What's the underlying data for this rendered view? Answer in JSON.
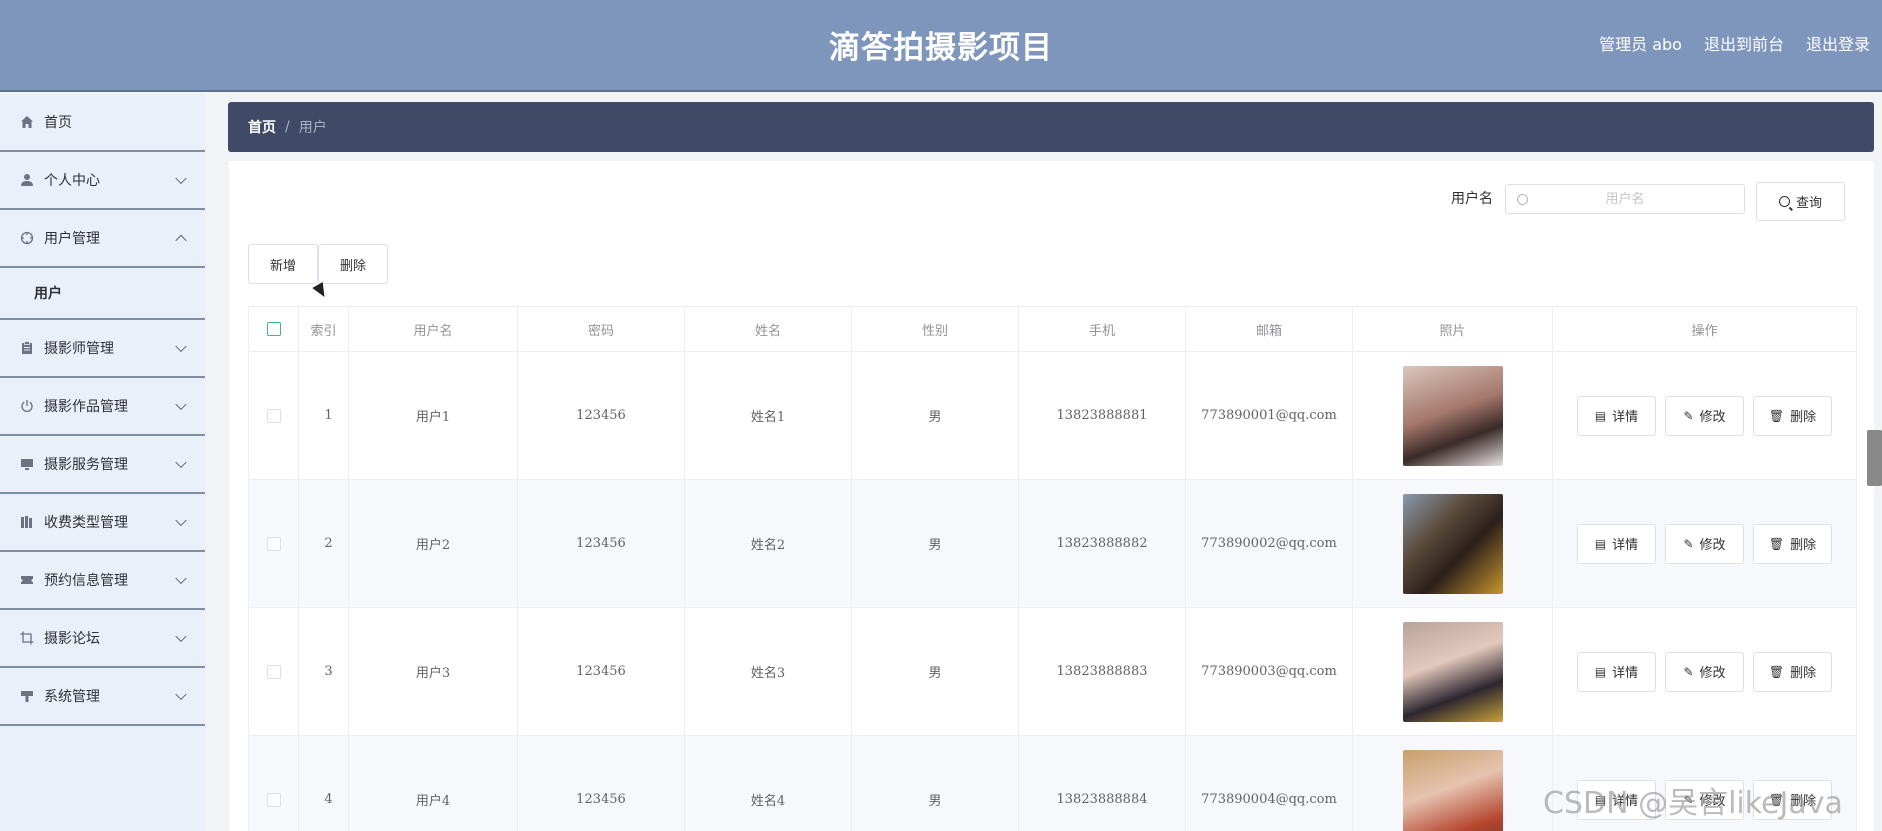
{
  "header": {
    "title": "滴答拍摄影项目",
    "admin": "管理员 abo",
    "to_front": "退出到前台",
    "logout": "退出登录"
  },
  "sidebar": {
    "items": [
      {
        "label": "首页",
        "icon": "home-icon"
      },
      {
        "label": "个人中心",
        "icon": "user-icon"
      },
      {
        "label": "用户管理",
        "icon": "crosshair-icon",
        "expanded": true,
        "sub": [
          "用户"
        ]
      },
      {
        "label": "摄影师管理",
        "icon": "clipboard-icon"
      },
      {
        "label": "摄影作品管理",
        "icon": "power-icon"
      },
      {
        "label": "摄影服务管理",
        "icon": "monitor-icon"
      },
      {
        "label": "收费类型管理",
        "icon": "books-icon"
      },
      {
        "label": "预约信息管理",
        "icon": "ticket-icon"
      },
      {
        "label": "摄影论坛",
        "icon": "crop-icon"
      },
      {
        "label": "系统管理",
        "icon": "tool-icon"
      }
    ]
  },
  "breadcrumb": {
    "home": "首页",
    "sep": "/",
    "current": "用户"
  },
  "search": {
    "label": "用户名",
    "placeholder": "用户名",
    "value": "",
    "button": "查询"
  },
  "actions": {
    "add": "新增",
    "delete": "删除"
  },
  "table": {
    "columns": [
      "索引",
      "用户名",
      "密码",
      "姓名",
      "性别",
      "手机",
      "邮箱",
      "照片",
      "操作"
    ],
    "rows": [
      {
        "index": "1",
        "username": "用户1",
        "password": "123456",
        "name": "姓名1",
        "gender": "男",
        "phone": "13823888881",
        "email": "773890001@qq.com"
      },
      {
        "index": "2",
        "username": "用户2",
        "password": "123456",
        "name": "姓名2",
        "gender": "男",
        "phone": "13823888882",
        "email": "773890002@qq.com"
      },
      {
        "index": "3",
        "username": "用户3",
        "password": "123456",
        "name": "姓名3",
        "gender": "男",
        "phone": "13823888883",
        "email": "773890003@qq.com"
      },
      {
        "index": "4",
        "username": "用户4",
        "password": "123456",
        "name": "姓名4",
        "gender": "男",
        "phone": "13823888884",
        "email": "773890004@qq.com"
      }
    ],
    "row_actions": {
      "detail": "详情",
      "edit": "修改",
      "delete": "删除"
    }
  },
  "watermark": "CSDN @吴言likeJava",
  "colors": {
    "header": "#7f96bc",
    "breadcrumb": "#3e4a66",
    "sidebar": "#e9f0fa",
    "checkbox_accent": "#3fb68e"
  }
}
